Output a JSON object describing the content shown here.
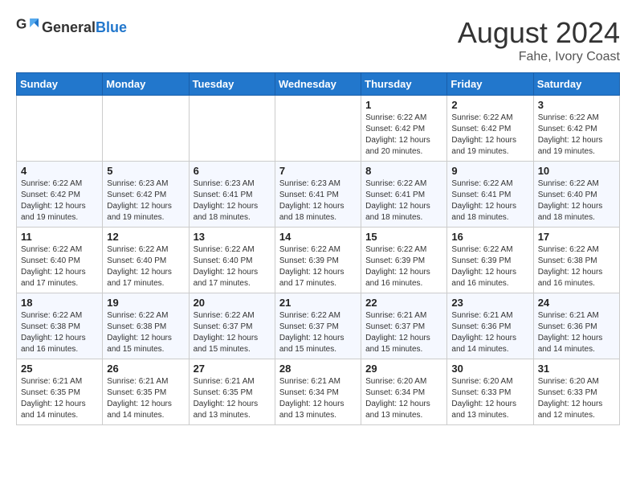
{
  "header": {
    "logo_general": "General",
    "logo_blue": "Blue",
    "month_year": "August 2024",
    "location": "Fahe, Ivory Coast"
  },
  "days": [
    "Sunday",
    "Monday",
    "Tuesday",
    "Wednesday",
    "Thursday",
    "Friday",
    "Saturday"
  ],
  "weeks": [
    [
      {
        "date": "",
        "info": ""
      },
      {
        "date": "",
        "info": ""
      },
      {
        "date": "",
        "info": ""
      },
      {
        "date": "",
        "info": ""
      },
      {
        "date": "1",
        "info": "Sunrise: 6:22 AM\nSunset: 6:42 PM\nDaylight: 12 hours and 20 minutes."
      },
      {
        "date": "2",
        "info": "Sunrise: 6:22 AM\nSunset: 6:42 PM\nDaylight: 12 hours and 19 minutes."
      },
      {
        "date": "3",
        "info": "Sunrise: 6:22 AM\nSunset: 6:42 PM\nDaylight: 12 hours and 19 minutes."
      }
    ],
    [
      {
        "date": "4",
        "info": "Sunrise: 6:22 AM\nSunset: 6:42 PM\nDaylight: 12 hours and 19 minutes."
      },
      {
        "date": "5",
        "info": "Sunrise: 6:23 AM\nSunset: 6:42 PM\nDaylight: 12 hours and 19 minutes."
      },
      {
        "date": "6",
        "info": "Sunrise: 6:23 AM\nSunset: 6:41 PM\nDaylight: 12 hours and 18 minutes."
      },
      {
        "date": "7",
        "info": "Sunrise: 6:23 AM\nSunset: 6:41 PM\nDaylight: 12 hours and 18 minutes."
      },
      {
        "date": "8",
        "info": "Sunrise: 6:22 AM\nSunset: 6:41 PM\nDaylight: 12 hours and 18 minutes."
      },
      {
        "date": "9",
        "info": "Sunrise: 6:22 AM\nSunset: 6:41 PM\nDaylight: 12 hours and 18 minutes."
      },
      {
        "date": "10",
        "info": "Sunrise: 6:22 AM\nSunset: 6:40 PM\nDaylight: 12 hours and 18 minutes."
      }
    ],
    [
      {
        "date": "11",
        "info": "Sunrise: 6:22 AM\nSunset: 6:40 PM\nDaylight: 12 hours and 17 minutes."
      },
      {
        "date": "12",
        "info": "Sunrise: 6:22 AM\nSunset: 6:40 PM\nDaylight: 12 hours and 17 minutes."
      },
      {
        "date": "13",
        "info": "Sunrise: 6:22 AM\nSunset: 6:40 PM\nDaylight: 12 hours and 17 minutes."
      },
      {
        "date": "14",
        "info": "Sunrise: 6:22 AM\nSunset: 6:39 PM\nDaylight: 12 hours and 17 minutes."
      },
      {
        "date": "15",
        "info": "Sunrise: 6:22 AM\nSunset: 6:39 PM\nDaylight: 12 hours and 16 minutes."
      },
      {
        "date": "16",
        "info": "Sunrise: 6:22 AM\nSunset: 6:39 PM\nDaylight: 12 hours and 16 minutes."
      },
      {
        "date": "17",
        "info": "Sunrise: 6:22 AM\nSunset: 6:38 PM\nDaylight: 12 hours and 16 minutes."
      }
    ],
    [
      {
        "date": "18",
        "info": "Sunrise: 6:22 AM\nSunset: 6:38 PM\nDaylight: 12 hours and 16 minutes."
      },
      {
        "date": "19",
        "info": "Sunrise: 6:22 AM\nSunset: 6:38 PM\nDaylight: 12 hours and 15 minutes."
      },
      {
        "date": "20",
        "info": "Sunrise: 6:22 AM\nSunset: 6:37 PM\nDaylight: 12 hours and 15 minutes."
      },
      {
        "date": "21",
        "info": "Sunrise: 6:22 AM\nSunset: 6:37 PM\nDaylight: 12 hours and 15 minutes."
      },
      {
        "date": "22",
        "info": "Sunrise: 6:21 AM\nSunset: 6:37 PM\nDaylight: 12 hours and 15 minutes."
      },
      {
        "date": "23",
        "info": "Sunrise: 6:21 AM\nSunset: 6:36 PM\nDaylight: 12 hours and 14 minutes."
      },
      {
        "date": "24",
        "info": "Sunrise: 6:21 AM\nSunset: 6:36 PM\nDaylight: 12 hours and 14 minutes."
      }
    ],
    [
      {
        "date": "25",
        "info": "Sunrise: 6:21 AM\nSunset: 6:35 PM\nDaylight: 12 hours and 14 minutes."
      },
      {
        "date": "26",
        "info": "Sunrise: 6:21 AM\nSunset: 6:35 PM\nDaylight: 12 hours and 14 minutes."
      },
      {
        "date": "27",
        "info": "Sunrise: 6:21 AM\nSunset: 6:35 PM\nDaylight: 12 hours and 13 minutes."
      },
      {
        "date": "28",
        "info": "Sunrise: 6:21 AM\nSunset: 6:34 PM\nDaylight: 12 hours and 13 minutes."
      },
      {
        "date": "29",
        "info": "Sunrise: 6:20 AM\nSunset: 6:34 PM\nDaylight: 12 hours and 13 minutes."
      },
      {
        "date": "30",
        "info": "Sunrise: 6:20 AM\nSunset: 6:33 PM\nDaylight: 12 hours and 13 minutes."
      },
      {
        "date": "31",
        "info": "Sunrise: 6:20 AM\nSunset: 6:33 PM\nDaylight: 12 hours and 12 minutes."
      }
    ]
  ]
}
